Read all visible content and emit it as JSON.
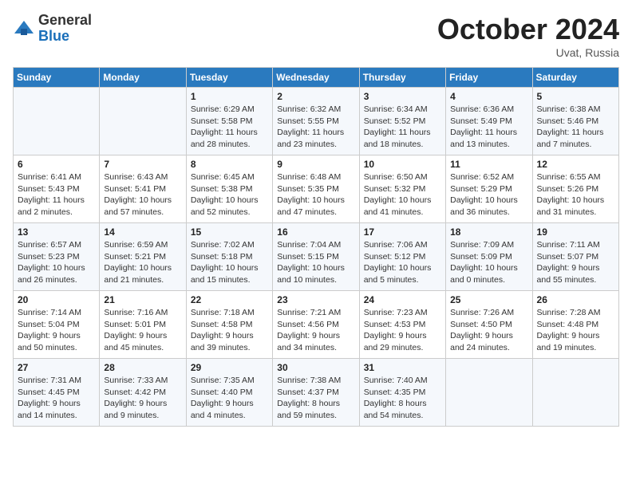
{
  "header": {
    "logo_general": "General",
    "logo_blue": "Blue",
    "month": "October 2024",
    "location": "Uvat, Russia"
  },
  "days_of_week": [
    "Sunday",
    "Monday",
    "Tuesday",
    "Wednesday",
    "Thursday",
    "Friday",
    "Saturday"
  ],
  "weeks": [
    [
      {
        "day": "",
        "sunrise": "",
        "sunset": "",
        "daylight": ""
      },
      {
        "day": "",
        "sunrise": "",
        "sunset": "",
        "daylight": ""
      },
      {
        "day": "1",
        "sunrise": "Sunrise: 6:29 AM",
        "sunset": "Sunset: 5:58 PM",
        "daylight": "Daylight: 11 hours and 28 minutes."
      },
      {
        "day": "2",
        "sunrise": "Sunrise: 6:32 AM",
        "sunset": "Sunset: 5:55 PM",
        "daylight": "Daylight: 11 hours and 23 minutes."
      },
      {
        "day": "3",
        "sunrise": "Sunrise: 6:34 AM",
        "sunset": "Sunset: 5:52 PM",
        "daylight": "Daylight: 11 hours and 18 minutes."
      },
      {
        "day": "4",
        "sunrise": "Sunrise: 6:36 AM",
        "sunset": "Sunset: 5:49 PM",
        "daylight": "Daylight: 11 hours and 13 minutes."
      },
      {
        "day": "5",
        "sunrise": "Sunrise: 6:38 AM",
        "sunset": "Sunset: 5:46 PM",
        "daylight": "Daylight: 11 hours and 7 minutes."
      }
    ],
    [
      {
        "day": "6",
        "sunrise": "Sunrise: 6:41 AM",
        "sunset": "Sunset: 5:43 PM",
        "daylight": "Daylight: 11 hours and 2 minutes."
      },
      {
        "day": "7",
        "sunrise": "Sunrise: 6:43 AM",
        "sunset": "Sunset: 5:41 PM",
        "daylight": "Daylight: 10 hours and 57 minutes."
      },
      {
        "day": "8",
        "sunrise": "Sunrise: 6:45 AM",
        "sunset": "Sunset: 5:38 PM",
        "daylight": "Daylight: 10 hours and 52 minutes."
      },
      {
        "day": "9",
        "sunrise": "Sunrise: 6:48 AM",
        "sunset": "Sunset: 5:35 PM",
        "daylight": "Daylight: 10 hours and 47 minutes."
      },
      {
        "day": "10",
        "sunrise": "Sunrise: 6:50 AM",
        "sunset": "Sunset: 5:32 PM",
        "daylight": "Daylight: 10 hours and 41 minutes."
      },
      {
        "day": "11",
        "sunrise": "Sunrise: 6:52 AM",
        "sunset": "Sunset: 5:29 PM",
        "daylight": "Daylight: 10 hours and 36 minutes."
      },
      {
        "day": "12",
        "sunrise": "Sunrise: 6:55 AM",
        "sunset": "Sunset: 5:26 PM",
        "daylight": "Daylight: 10 hours and 31 minutes."
      }
    ],
    [
      {
        "day": "13",
        "sunrise": "Sunrise: 6:57 AM",
        "sunset": "Sunset: 5:23 PM",
        "daylight": "Daylight: 10 hours and 26 minutes."
      },
      {
        "day": "14",
        "sunrise": "Sunrise: 6:59 AM",
        "sunset": "Sunset: 5:21 PM",
        "daylight": "Daylight: 10 hours and 21 minutes."
      },
      {
        "day": "15",
        "sunrise": "Sunrise: 7:02 AM",
        "sunset": "Sunset: 5:18 PM",
        "daylight": "Daylight: 10 hours and 15 minutes."
      },
      {
        "day": "16",
        "sunrise": "Sunrise: 7:04 AM",
        "sunset": "Sunset: 5:15 PM",
        "daylight": "Daylight: 10 hours and 10 minutes."
      },
      {
        "day": "17",
        "sunrise": "Sunrise: 7:06 AM",
        "sunset": "Sunset: 5:12 PM",
        "daylight": "Daylight: 10 hours and 5 minutes."
      },
      {
        "day": "18",
        "sunrise": "Sunrise: 7:09 AM",
        "sunset": "Sunset: 5:09 PM",
        "daylight": "Daylight: 10 hours and 0 minutes."
      },
      {
        "day": "19",
        "sunrise": "Sunrise: 7:11 AM",
        "sunset": "Sunset: 5:07 PM",
        "daylight": "Daylight: 9 hours and 55 minutes."
      }
    ],
    [
      {
        "day": "20",
        "sunrise": "Sunrise: 7:14 AM",
        "sunset": "Sunset: 5:04 PM",
        "daylight": "Daylight: 9 hours and 50 minutes."
      },
      {
        "day": "21",
        "sunrise": "Sunrise: 7:16 AM",
        "sunset": "Sunset: 5:01 PM",
        "daylight": "Daylight: 9 hours and 45 minutes."
      },
      {
        "day": "22",
        "sunrise": "Sunrise: 7:18 AM",
        "sunset": "Sunset: 4:58 PM",
        "daylight": "Daylight: 9 hours and 39 minutes."
      },
      {
        "day": "23",
        "sunrise": "Sunrise: 7:21 AM",
        "sunset": "Sunset: 4:56 PM",
        "daylight": "Daylight: 9 hours and 34 minutes."
      },
      {
        "day": "24",
        "sunrise": "Sunrise: 7:23 AM",
        "sunset": "Sunset: 4:53 PM",
        "daylight": "Daylight: 9 hours and 29 minutes."
      },
      {
        "day": "25",
        "sunrise": "Sunrise: 7:26 AM",
        "sunset": "Sunset: 4:50 PM",
        "daylight": "Daylight: 9 hours and 24 minutes."
      },
      {
        "day": "26",
        "sunrise": "Sunrise: 7:28 AM",
        "sunset": "Sunset: 4:48 PM",
        "daylight": "Daylight: 9 hours and 19 minutes."
      }
    ],
    [
      {
        "day": "27",
        "sunrise": "Sunrise: 7:31 AM",
        "sunset": "Sunset: 4:45 PM",
        "daylight": "Daylight: 9 hours and 14 minutes."
      },
      {
        "day": "28",
        "sunrise": "Sunrise: 7:33 AM",
        "sunset": "Sunset: 4:42 PM",
        "daylight": "Daylight: 9 hours and 9 minutes."
      },
      {
        "day": "29",
        "sunrise": "Sunrise: 7:35 AM",
        "sunset": "Sunset: 4:40 PM",
        "daylight": "Daylight: 9 hours and 4 minutes."
      },
      {
        "day": "30",
        "sunrise": "Sunrise: 7:38 AM",
        "sunset": "Sunset: 4:37 PM",
        "daylight": "Daylight: 8 hours and 59 minutes."
      },
      {
        "day": "31",
        "sunrise": "Sunrise: 7:40 AM",
        "sunset": "Sunset: 4:35 PM",
        "daylight": "Daylight: 8 hours and 54 minutes."
      },
      {
        "day": "",
        "sunrise": "",
        "sunset": "",
        "daylight": ""
      },
      {
        "day": "",
        "sunrise": "",
        "sunset": "",
        "daylight": ""
      }
    ]
  ]
}
